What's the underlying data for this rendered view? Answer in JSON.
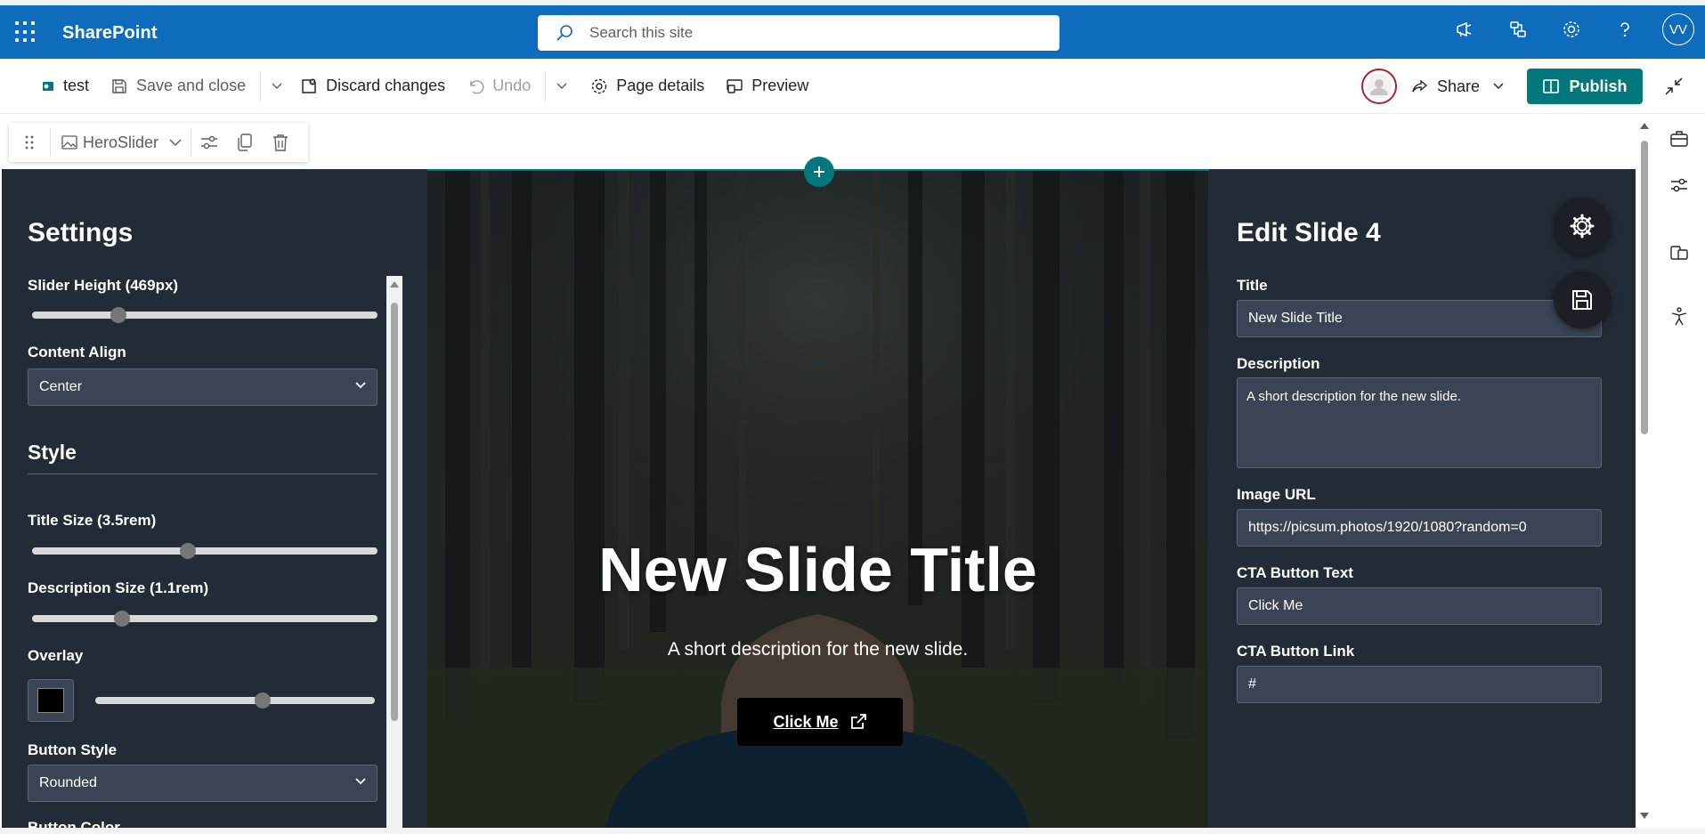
{
  "suite": {
    "app_name": "SharePoint",
    "search_placeholder": "Search this site",
    "user_initials": "VV"
  },
  "command_bar": {
    "page_name": "test",
    "save_close": "Save and close",
    "discard": "Discard changes",
    "undo": "Undo",
    "page_details": "Page details",
    "preview": "Preview",
    "share": "Share",
    "publish": "Publish"
  },
  "webpart_toolbar": {
    "name": "HeroSlider"
  },
  "settings": {
    "title": "Settings",
    "slider_height_label": "Slider Height (469px)",
    "slider_height_value": 0.25,
    "content_align_label": "Content Align",
    "content_align_value": "Center",
    "style_heading": "Style",
    "title_size_label": "Title Size (3.5rem)",
    "title_size_value": 0.45,
    "desc_size_label": "Description Size (1.1rem)",
    "desc_size_value": 0.26,
    "overlay_label": "Overlay",
    "overlay_color": "#000000",
    "overlay_value": 0.6,
    "button_style_label": "Button Style",
    "button_style_value": "Rounded",
    "button_color_label": "Button Color"
  },
  "hero": {
    "title": "New Slide Title",
    "description": "A short description for the new slide.",
    "cta": "Click Me"
  },
  "edit_slide": {
    "title": "Edit Slide 4",
    "title_label": "Title",
    "title_value": "New Slide Title",
    "description_label": "Description",
    "description_value": "A short description for the new slide.",
    "image_url_label": "Image URL",
    "image_url_value": "https://picsum.photos/1920/1080?random=0",
    "cta_text_label": "CTA Button Text",
    "cta_text_value": "Click Me",
    "cta_link_label": "CTA Button Link",
    "cta_link_value": "#"
  },
  "colors": {
    "suite_blue": "#0f6cbd",
    "teal": "#03787c",
    "panel_bg": "#232b36"
  }
}
